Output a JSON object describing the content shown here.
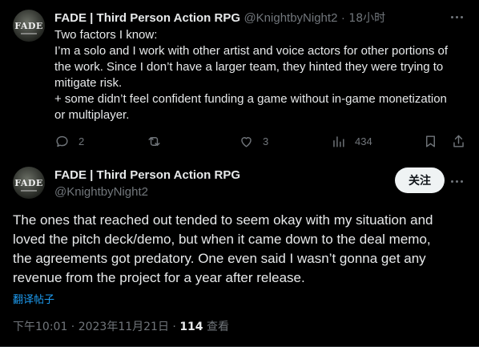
{
  "reply_tweet": {
    "author_name": "FADE | Third Person Action RPG",
    "author_handle": "@KnightbyNight2",
    "time_sep": "·",
    "time": "18小时",
    "avatar_text": "FADE",
    "lines": [
      "Two factors I know:",
      "I’m a solo and I work with other artist and voice actors for other portions of",
      "the work. Since I don’t have a larger team, they hinted they were trying to",
      "mitigate risk.",
      "+ some didn’t feel confident funding a game without in-game monetization",
      "or multiplayer."
    ],
    "actions": {
      "reply_count": "2",
      "retweet_count": "",
      "like_count": "3",
      "view_count": "434"
    }
  },
  "main_tweet": {
    "author_name": "FADE | Third Person Action RPG",
    "author_handle": "@KnightbyNight2",
    "avatar_text": "FADE",
    "follow_label": "关注",
    "lines": [
      "The ones that reached out tended to seem okay with my situation and",
      "loved the pitch deck/demo, but when it came down to the deal memo,",
      "the agreements got predatory. One even said I wasn’t gonna get any",
      "revenue from the project for a year after release."
    ],
    "translate_label": "翻译帖子",
    "timestamp": "下午10:01 · 2023年11月21日 ·",
    "views_count": "114",
    "views_label": "查看"
  },
  "colors": {
    "background": "#000000",
    "text": "#e7e9ea",
    "muted": "#71767b",
    "link": "#1d9bf0",
    "divider": "#2f3336"
  }
}
